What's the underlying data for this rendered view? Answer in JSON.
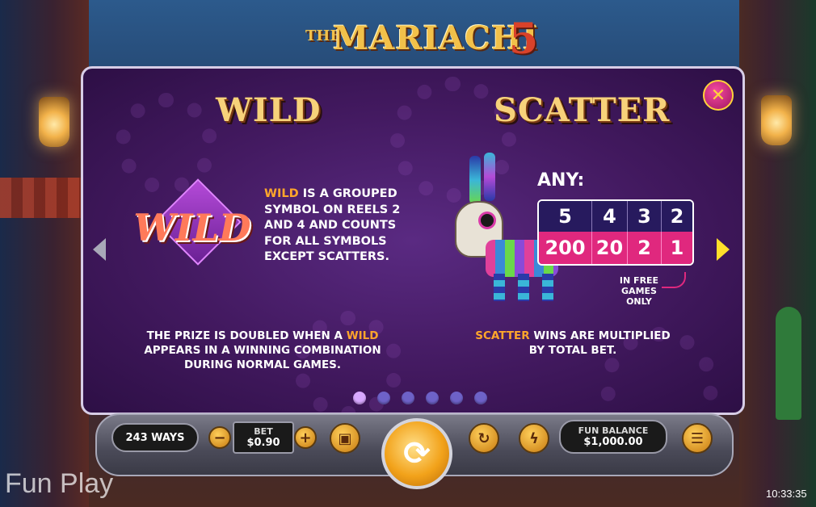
{
  "logo": {
    "the": "THE",
    "main": "MARIACHI",
    "number": "5"
  },
  "close_glyph": "✕",
  "wild": {
    "title": "WILD",
    "symbol_text": "WILD",
    "desc_keyword": "WILD",
    "desc_rest": " IS A GROUPED SYMBOL ON REELS 2 AND 4 AND COUNTS FOR ALL SYMBOLS EXCEPT SCATTERS.",
    "note_line1_pre": "THE PRIZE IS DOUBLED WHEN A ",
    "note_keyword": "WILD",
    "note_line2": "APPEARS IN A WINNING COMBINATION",
    "note_line3": "DURING NORMAL GAMES."
  },
  "scatter": {
    "title": "SCATTER",
    "any_label": "ANY:",
    "paytable": {
      "counts": [
        "5",
        "4",
        "3",
        "2"
      ],
      "payouts": [
        "200",
        "20",
        "2",
        "1"
      ]
    },
    "free_note": "IN FREE GAMES ONLY",
    "note_keyword": "SCATTER",
    "note_rest_line1": " WINS ARE MULTIPLIED",
    "note_line2": "BY TOTAL BET."
  },
  "pagination": {
    "total": 6,
    "active_index": 0
  },
  "controls": {
    "ways": "243 WAYS",
    "bet_label": "BET",
    "bet_value": "$0.90",
    "minus": "−",
    "plus": "+",
    "balance_label": "FUN BALANCE",
    "balance_value": "$1,000.00",
    "menu_glyph": "☰"
  },
  "footer": {
    "brand": "Fun Play",
    "clock": "10:33:35"
  },
  "colors": {
    "accent_orange": "#ffa62b",
    "payout_pink": "#e0287e",
    "header_navy": "#271a5e"
  }
}
